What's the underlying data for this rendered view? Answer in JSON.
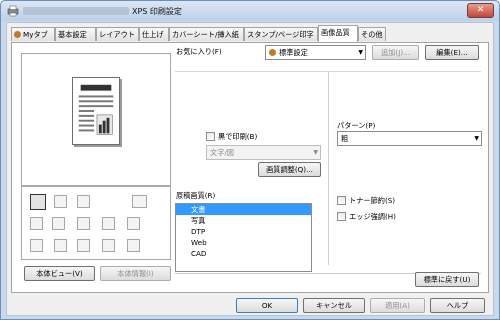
{
  "window": {
    "title": "XPS 印刷設定",
    "close_glyph": "✕"
  },
  "tabs": [
    {
      "label": "Myタブ"
    },
    {
      "label": "基本設定"
    },
    {
      "label": "レイアウト"
    },
    {
      "label": "仕上げ"
    },
    {
      "label": "カバーシート/挿入紙"
    },
    {
      "label": "スタンプ/ページ印字"
    },
    {
      "label": "画像品質"
    },
    {
      "label": "その他"
    }
  ],
  "favorites": {
    "label": "お気に入り(F)",
    "value": "標準設定",
    "add_button": "追加(J)...",
    "edit_button": "編集(E)..."
  },
  "left_panel": {
    "view_button": "本体ビュー(V)",
    "info_button": "本体情報(I)"
  },
  "print_black": {
    "label": "黒で印刷(B)",
    "select_value": "文字/図",
    "adjust_button": "画質調整(Q)..."
  },
  "original_quality": {
    "label": "原稿画質(R)",
    "items": [
      "文書",
      "写真",
      "DTP",
      "Web",
      "CAD"
    ],
    "selected_index": 0
  },
  "pattern": {
    "label": "パターン(P)",
    "value": "粗"
  },
  "toner_save": {
    "label": "トナー節約(S)"
  },
  "edge_enhance": {
    "label": "エッジ強調(H)"
  },
  "restore_button": "標準に戻す(U)",
  "footer": {
    "ok": "OK",
    "cancel": "キャンセル",
    "apply": "適用(A)",
    "help": "ヘルプ"
  },
  "colors": {
    "selection": "#3399ff",
    "window_frame": "#c9d9ec"
  }
}
